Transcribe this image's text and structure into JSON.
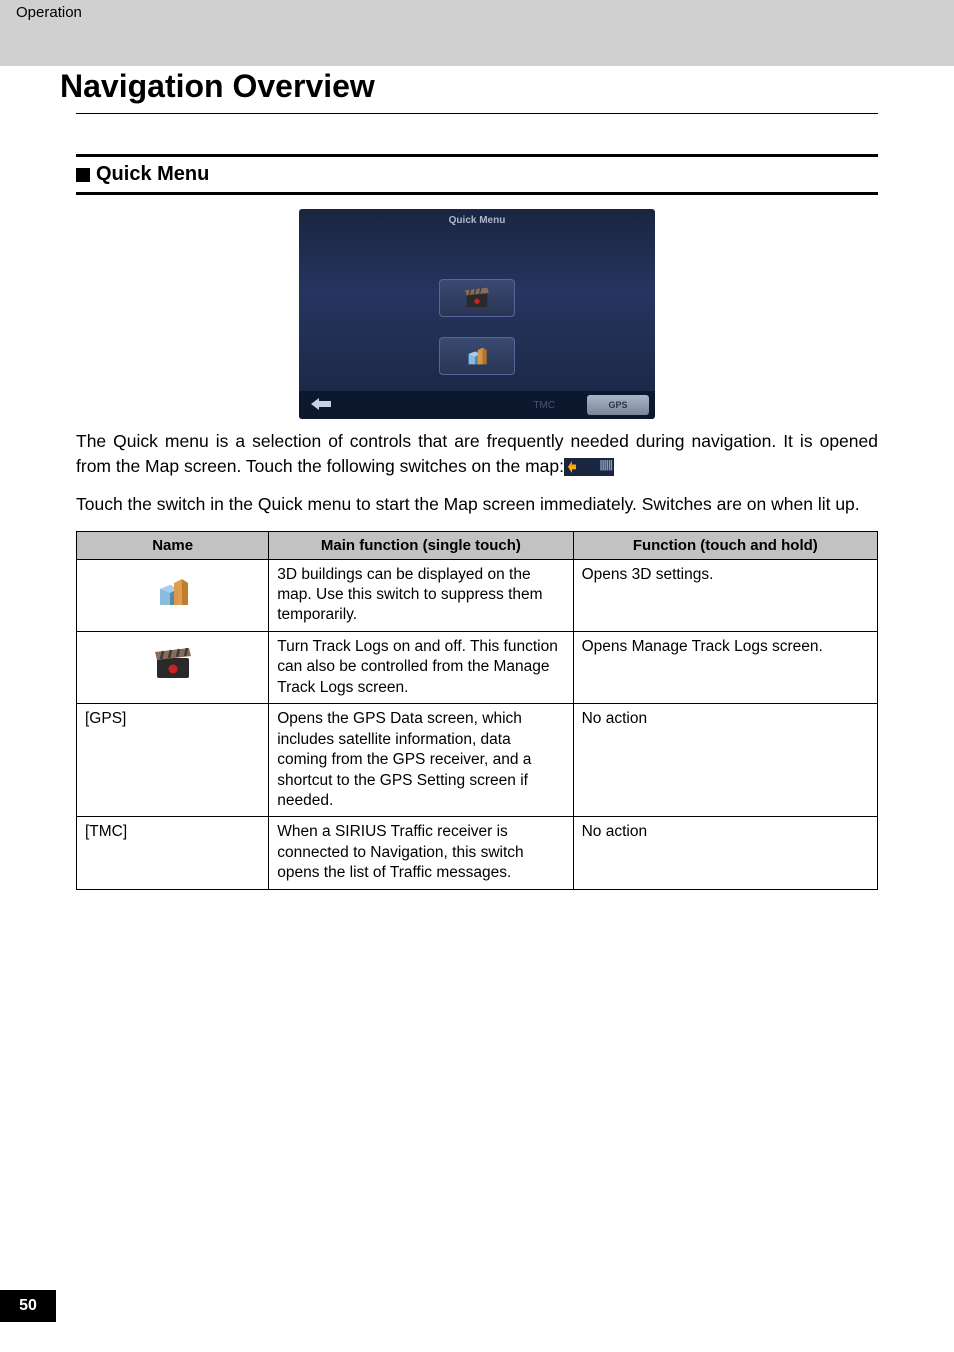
{
  "header": {
    "category": "Operation",
    "title": "Navigation Overview"
  },
  "section": {
    "heading": "Quick Menu"
  },
  "screenshot": {
    "title": "Quick Menu",
    "tmc": "TMC",
    "gps": "GPS"
  },
  "body": {
    "para1_a": "The Quick menu is a selection of controls that are frequently needed during navigation. It is opened from the Map screen. Touch the following switches on the map:",
    "para2": "Touch the switch in the Quick menu to start the Map screen immediately. Switches are on when lit up."
  },
  "table": {
    "headers": {
      "name": "Name",
      "main": "Main function (single touch)",
      "hold": "Function (touch and hold)"
    },
    "rows": [
      {
        "name_icon": "building-3d-icon",
        "name_text": "",
        "main": "3D buildings can be displayed on the map. Use this switch to suppress them temporarily.",
        "hold": "Opens 3D settings."
      },
      {
        "name_icon": "clapperboard-icon",
        "name_text": "",
        "main": "Turn Track Logs on and off. This function can also be controlled from the Manage Track Logs screen.",
        "hold": "Opens Manage Track Logs screen."
      },
      {
        "name_icon": "",
        "name_text": "[GPS]",
        "main": "Opens the GPS Data screen, which includes satellite information, data coming from the GPS receiver, and a shortcut to the GPS Setting screen if needed.",
        "hold": "No action"
      },
      {
        "name_icon": "",
        "name_text": "[TMC]",
        "main": "When a SIRIUS Traffic receiver is connected to Navigation, this switch opens the list of Traffic messages.",
        "hold": "No action"
      }
    ]
  },
  "page_number": "50"
}
